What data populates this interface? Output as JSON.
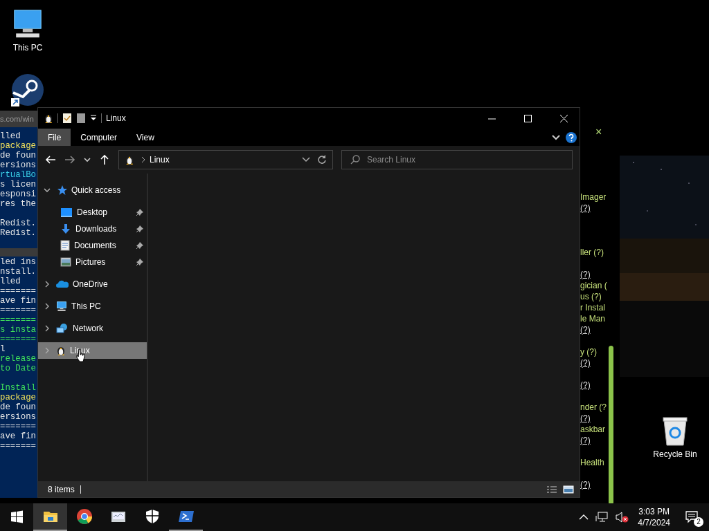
{
  "desktop_icons": [
    {
      "kind": "pc",
      "label": "This PC"
    },
    {
      "kind": "app"
    },
    {
      "kind": "bin",
      "label": "Recycle Bin"
    }
  ],
  "terminal": {
    "address": "s.com/win",
    "lines": [
      {
        "kind": "text",
        "text": "lled",
        "color": "#e6e6e6"
      },
      {
        "kind": "text",
        "text": "package",
        "color": "#f2e25a"
      },
      {
        "kind": "text",
        "text": "de foun",
        "color": "#e6e6e6"
      },
      {
        "kind": "text",
        "text": "ersions",
        "color": "#e6e6e6"
      },
      {
        "kind": "text",
        "text": "rtualBo",
        "color": "#3ad0e8"
      },
      {
        "kind": "text",
        "text": "s licen",
        "color": "#e6e6e6"
      },
      {
        "kind": "text",
        "text": "esponsi",
        "color": "#e6e6e6"
      },
      {
        "kind": "text",
        "text": "res the",
        "color": "#e6e6e6"
      },
      {
        "kind": "blank"
      },
      {
        "kind": "text",
        "text": "Redist.",
        "color": "#e6e6e6"
      },
      {
        "kind": "text",
        "text": "Redist.",
        "color": "#e6e6e6"
      },
      {
        "kind": "blank"
      },
      {
        "kind": "band"
      },
      {
        "kind": "text",
        "text": "led ins",
        "color": "#e6e6e6"
      },
      {
        "kind": "text",
        "text": "nstall.",
        "color": "#e6e6e6"
      },
      {
        "kind": "text",
        "text": "lled",
        "color": "#e6e6e6"
      },
      {
        "kind": "text",
        "text": "=======",
        "color": "#e6e6e6"
      },
      {
        "kind": "text",
        "text": "ave fin",
        "color": "#e6e6e6"
      },
      {
        "kind": "text",
        "text": "=======",
        "color": "#e6e6e6"
      },
      {
        "kind": "text",
        "text": "=======",
        "color": "#3fe05a"
      },
      {
        "kind": "text",
        "text": "s insta",
        "color": "#3fe05a"
      },
      {
        "kind": "text",
        "text": "=======",
        "color": "#3fe05a"
      },
      {
        "kind": "text",
        "text": "l",
        "color": "#e6e6e6"
      },
      {
        "kind": "text",
        "text": "release",
        "color": "#3fe05a"
      },
      {
        "kind": "text",
        "text": "to Date",
        "color": "#3fe05a"
      },
      {
        "kind": "blank"
      },
      {
        "kind": "text",
        "text": "Install",
        "color": "#3fe05a"
      },
      {
        "kind": "text",
        "text": "package",
        "color": "#f2e25a"
      },
      {
        "kind": "text",
        "text": "de foun",
        "color": "#e6e6e6"
      },
      {
        "kind": "text",
        "text": "ersions",
        "color": "#e6e6e6"
      },
      {
        "kind": "text",
        "text": "=======",
        "color": "#e6e6e6"
      },
      {
        "kind": "text",
        "text": "ave fin",
        "color": "#e6e6e6"
      },
      {
        "kind": "text",
        "text": "=======",
        "color": "#e6e6e6"
      }
    ]
  },
  "side_window": {
    "close": "×",
    "lines": [
      {
        "kind": "text",
        "text": "Imager"
      },
      {
        "kind": "link",
        "text": "(?)"
      },
      {
        "kind": "blank"
      },
      {
        "kind": "blank"
      },
      {
        "kind": "blank"
      },
      {
        "kind": "text",
        "text": "ller (?)"
      },
      {
        "kind": "blank"
      },
      {
        "kind": "link",
        "text": "(?)"
      },
      {
        "kind": "text",
        "text": "gician ("
      },
      {
        "kind": "text",
        "text": "us (?)"
      },
      {
        "kind": "text",
        "text": "r Instal"
      },
      {
        "kind": "text",
        "text": "le Man"
      },
      {
        "kind": "link",
        "text": "(?)"
      },
      {
        "kind": "blank"
      },
      {
        "kind": "text",
        "text": "y (?)"
      },
      {
        "kind": "link",
        "text": "(?)"
      },
      {
        "kind": "blank"
      },
      {
        "kind": "link",
        "text": "(?)"
      },
      {
        "kind": "blank"
      },
      {
        "kind": "text",
        "text": "nder (?"
      },
      {
        "kind": "link",
        "text": "(?)"
      },
      {
        "kind": "text",
        "text": "askbar"
      },
      {
        "kind": "link",
        "text": "(?)"
      },
      {
        "kind": "blank"
      },
      {
        "kind": "text",
        "text": "Health"
      },
      {
        "kind": "blank"
      },
      {
        "kind": "link",
        "text": "(?)"
      }
    ]
  },
  "explorer": {
    "title": "Linux",
    "ribbon_tabs": [
      {
        "label": "File",
        "selected": true
      },
      {
        "label": "Computer",
        "selected": false
      },
      {
        "label": "View",
        "selected": false
      }
    ],
    "address": {
      "path": "Linux"
    },
    "search": {
      "placeholder": "Search Linux"
    },
    "nav": [
      {
        "label": "Quick access",
        "kind": "star",
        "expanded": true,
        "selected": false,
        "children": [
          {
            "label": "Desktop",
            "kind": "desktop",
            "pinned": true,
            "selected": false
          },
          {
            "label": "Downloads",
            "kind": "download",
            "pinned": true,
            "selected": false
          },
          {
            "label": "Documents",
            "kind": "document",
            "pinned": true,
            "selected": false
          },
          {
            "label": "Pictures",
            "kind": "pictures",
            "pinned": true,
            "selected": false
          }
        ]
      },
      {
        "label": "OneDrive",
        "kind": "cloud",
        "expanded": false,
        "selected": false
      },
      {
        "label": "This PC",
        "kind": "pc",
        "expanded": false,
        "selected": false
      },
      {
        "label": "Network",
        "kind": "network",
        "expanded": false,
        "selected": false
      },
      {
        "label": "Linux",
        "kind": "linux",
        "expanded": false,
        "selected": true
      }
    ],
    "status": "8 items"
  },
  "taskbar": {
    "apps": [
      {
        "kind": "explorer",
        "running": true,
        "active": true
      },
      {
        "kind": "chrome",
        "running": false,
        "active": false
      },
      {
        "kind": "app",
        "running": false,
        "active": false
      },
      {
        "kind": "shield",
        "running": false,
        "active": false
      },
      {
        "kind": "terminal",
        "running": true,
        "active": false
      }
    ],
    "time": "3:03 PM",
    "date": "4/7/2024",
    "notifications": "2"
  }
}
